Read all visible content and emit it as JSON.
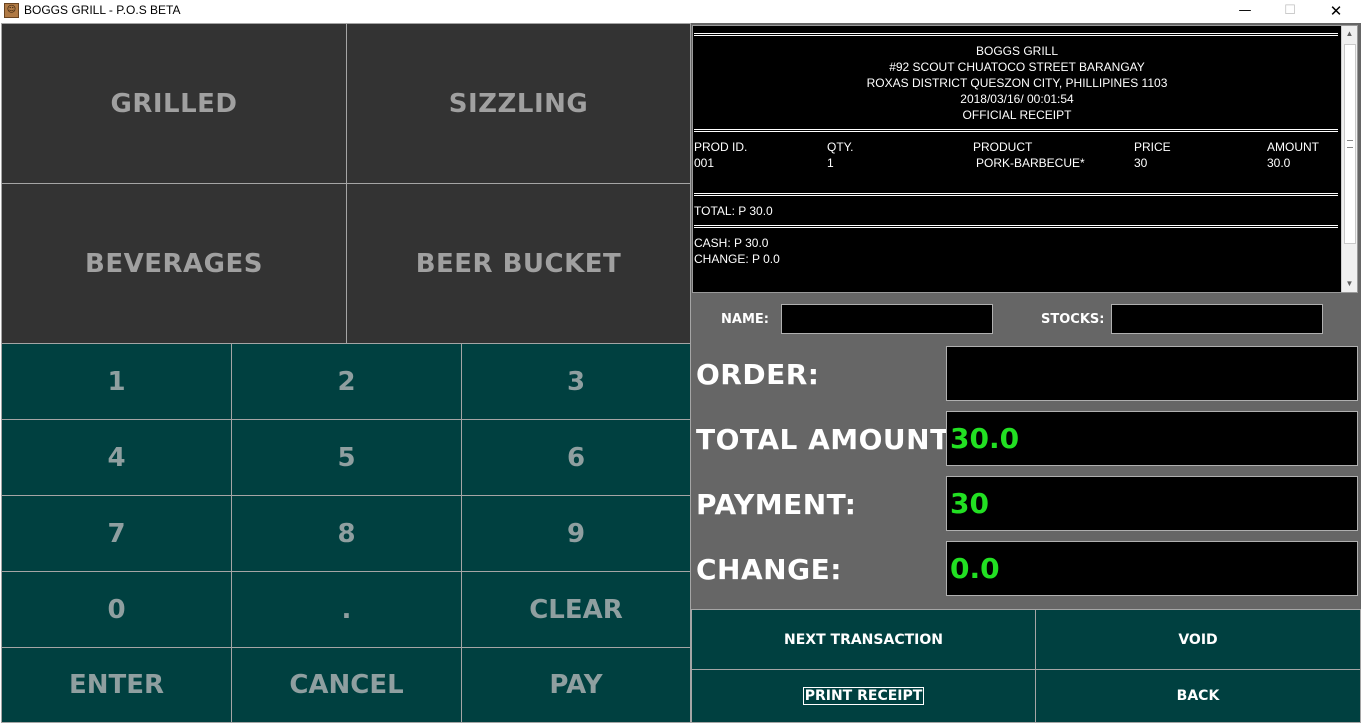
{
  "window": {
    "title": "BOGGS GRILL - P.O.S BETA",
    "controls": {
      "minimize": "—",
      "maximize": "☐",
      "close": "✕"
    }
  },
  "categories": [
    {
      "label": "GRILLED"
    },
    {
      "label": "SIZZLING"
    },
    {
      "label": "BEVERAGES"
    },
    {
      "label": "BEER BUCKET"
    }
  ],
  "keypad": [
    {
      "label": "1"
    },
    {
      "label": "2"
    },
    {
      "label": "3"
    },
    {
      "label": "4"
    },
    {
      "label": "5"
    },
    {
      "label": "6"
    },
    {
      "label": "7"
    },
    {
      "label": "8"
    },
    {
      "label": "9"
    },
    {
      "label": "0"
    },
    {
      "label": "."
    },
    {
      "label": "CLEAR"
    },
    {
      "label": "ENTER"
    },
    {
      "label": "CANCEL"
    },
    {
      "label": "PAY"
    }
  ],
  "receipt": {
    "store_name": "BOGGS GRILL",
    "address_line1": "#92 SCOUT CHUATOCO STREET BARANGAY",
    "address_line2": "ROXAS DISTRICT QUESZON CITY, PHILLIPINES 1103",
    "datetime": "2018/03/16/ 00:01:54",
    "doc_type": "OFFICIAL RECEIPT",
    "columns": [
      "PROD ID.",
      "QTY.",
      "PRODUCT",
      "PRICE",
      "AMOUNT"
    ],
    "rows": [
      [
        "001",
        "1",
        "PORK-BARBECUE*",
        "30",
        "30.0"
      ]
    ],
    "total": "TOTAL: P 30.0",
    "cash": "CASH: P 30.0",
    "change": "CHANGE: P 0.0"
  },
  "lookup": {
    "name_label": "NAME:",
    "name_value": "",
    "stocks_label": "STOCKS:",
    "stocks_value": ""
  },
  "summary": {
    "order_label": "ORDER:",
    "order_value": "",
    "total_label": "TOTAL AMOUNT:",
    "total_value": "30.0",
    "payment_label": "PAYMENT:",
    "payment_value": "30",
    "change_label": "CHANGE:",
    "change_value": "0.0"
  },
  "actions": {
    "next_transaction": "NEXT TRANSACTION",
    "void": "VOID",
    "print_receipt": "PRINT RECEIPT",
    "back": "BACK"
  },
  "colors": {
    "category_bg": "#333333",
    "keypad_bg": "#004040",
    "panel_bg": "#666666",
    "value_green": "#22e022"
  }
}
